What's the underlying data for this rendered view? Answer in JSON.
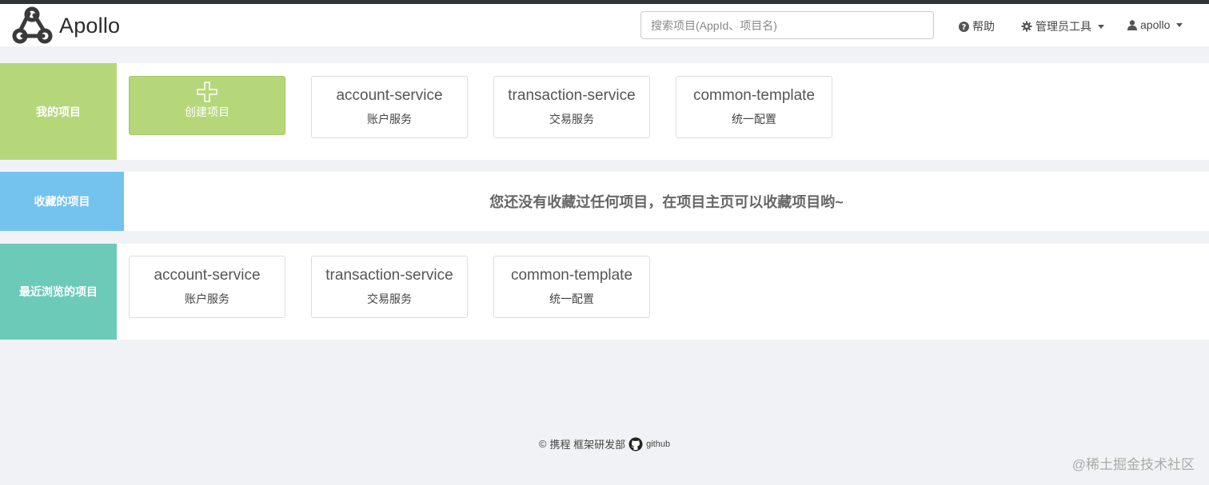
{
  "app": {
    "brand": "Apollo"
  },
  "search": {
    "placeholder": "搜索项目(AppId、项目名)"
  },
  "nav": {
    "help": "帮助",
    "admin_tools": "管理员工具",
    "user": "apollo"
  },
  "sections": {
    "my_projects": {
      "label": "我的项目",
      "color": "#b5d77a",
      "create_label": "创建项目",
      "items": [
        {
          "title": "account-service",
          "subtitle": "账户服务"
        },
        {
          "title": "transaction-service",
          "subtitle": "交易服务"
        },
        {
          "title": "common-template",
          "subtitle": "统一配置"
        }
      ]
    },
    "favorites": {
      "label": "收藏的项目",
      "color": "#74c3ef",
      "empty_message": "您还没有收藏过任何项目，在项目主页可以收藏项目哟~"
    },
    "recent": {
      "label": "最近浏览的项目",
      "color": "#6ccab9",
      "items": [
        {
          "title": "account-service",
          "subtitle": "账户服务"
        },
        {
          "title": "transaction-service",
          "subtitle": "交易服务"
        },
        {
          "title": "common-template",
          "subtitle": "统一配置"
        }
      ]
    }
  },
  "footer": {
    "copyright": "携程 框架研发部",
    "github": "github"
  },
  "watermark": "@稀土掘金技术社区",
  "colors": {
    "accent_green": "#b5d77a",
    "accent_blue": "#74c3ef",
    "accent_teal": "#6ccab9"
  }
}
